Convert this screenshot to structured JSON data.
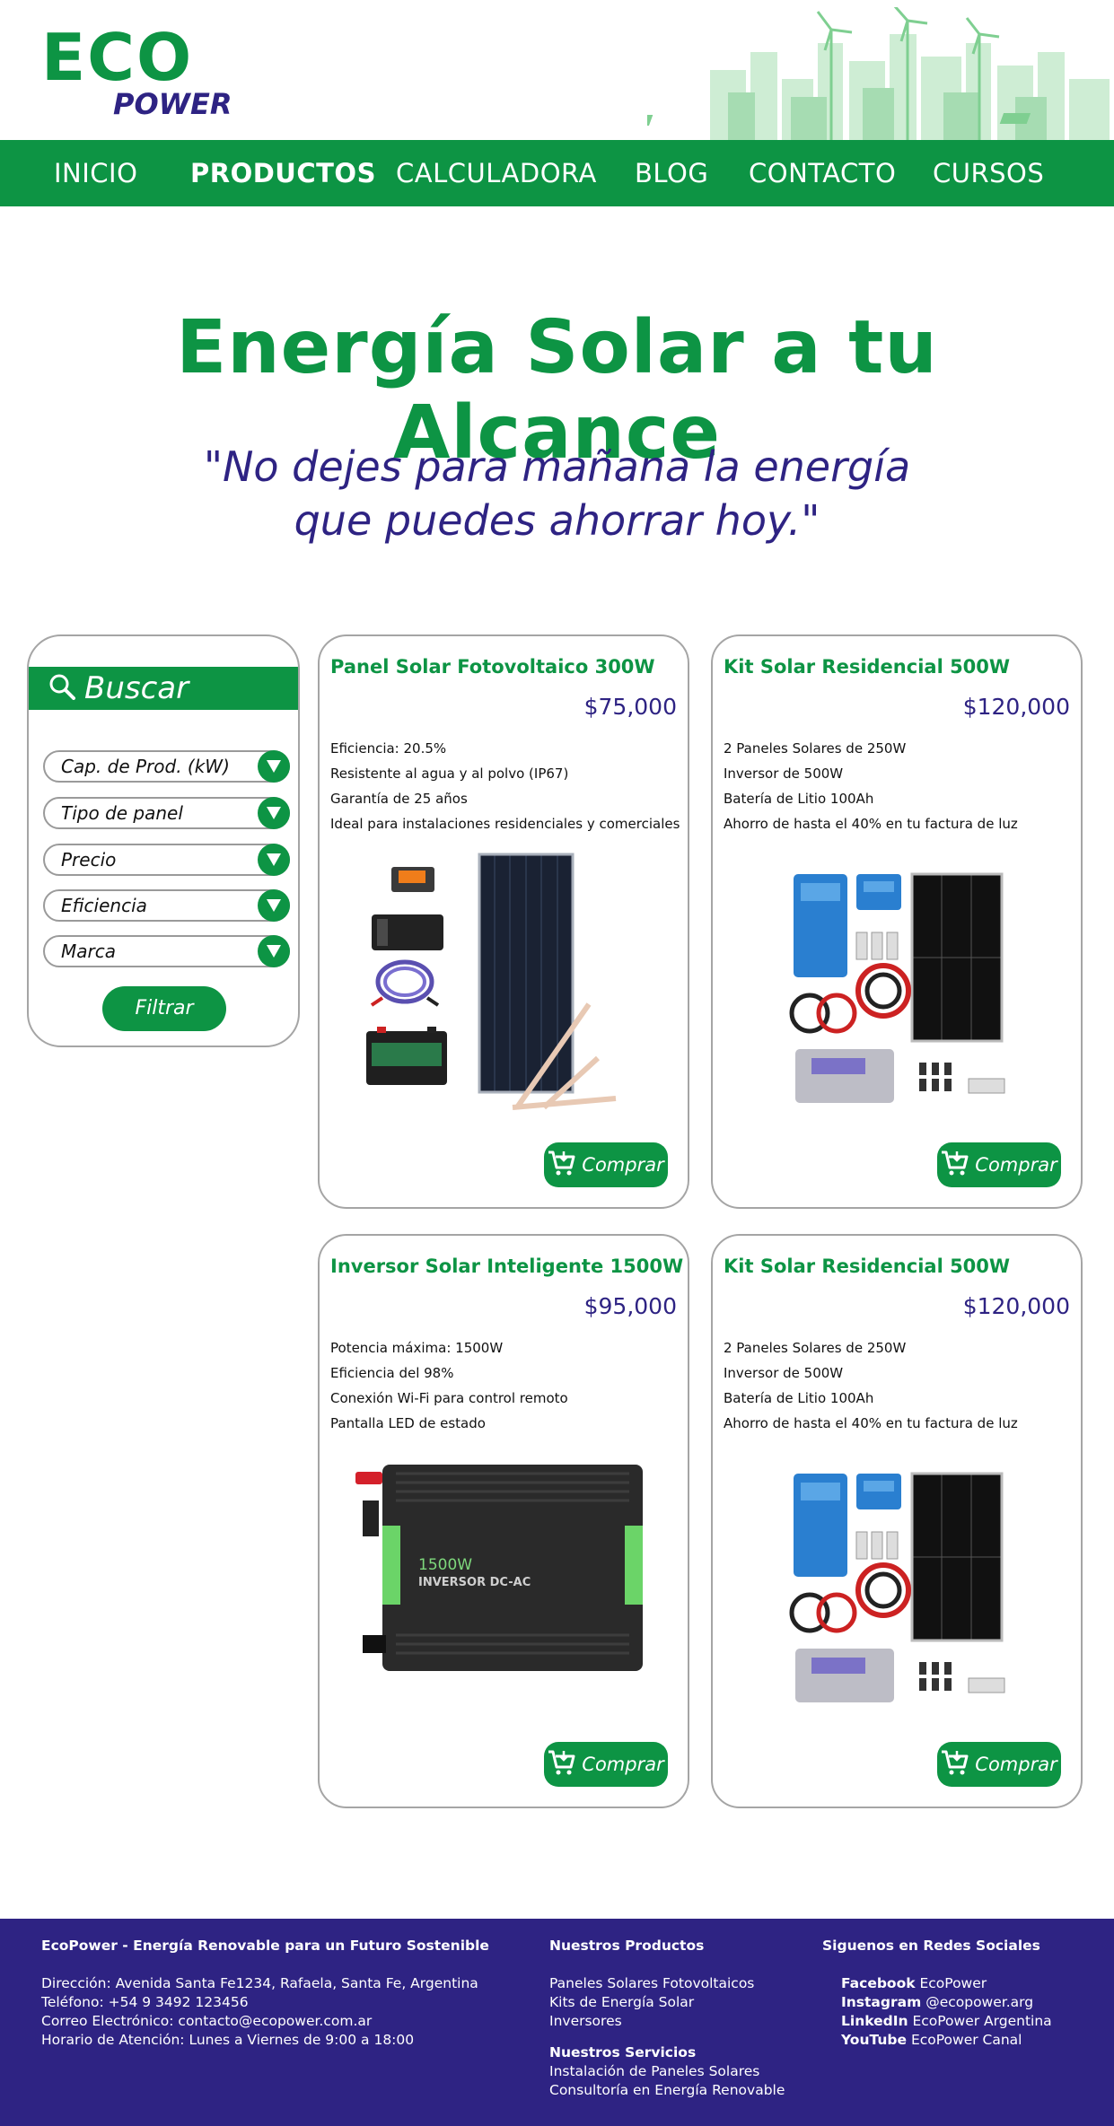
{
  "brand": {
    "logo_top": "ECO",
    "logo_bottom": "POWER"
  },
  "colors": {
    "green": "#0d9444",
    "purple": "#2e2383",
    "border": "#a5a5a5"
  },
  "nav": [
    {
      "label": "INICIO",
      "active": false
    },
    {
      "label": "PRODUCTOS",
      "active": true
    },
    {
      "label": "CALCULADORA",
      "active": false
    },
    {
      "label": "BLOG",
      "active": false
    },
    {
      "label": "CONTACTO",
      "active": false
    },
    {
      "label": "CURSOS",
      "active": false
    }
  ],
  "hero": {
    "title": "Energía Solar a tu Alcance",
    "quote_line1": "\"No dejes para mañana la energía",
    "quote_line2": "que puedes ahorrar hoy.\""
  },
  "search": {
    "title": "Buscar",
    "icon": "search-icon",
    "filters": [
      "Cap. de Prod. (kW)",
      "Tipo de panel",
      "Precio",
      "Eficiencia",
      "Marca"
    ],
    "button": "Filtrar"
  },
  "products": [
    {
      "name": "Panel Solar Fotovoltaico 300W",
      "price": "$75,000",
      "features": [
        "Eficiencia: 20.5%",
        "Resistente al agua y al polvo (IP67)",
        "Garantía de 25 años",
        "Ideal para instalaciones residenciales y comerciales"
      ],
      "image": "solar-panel-kit-image",
      "buy": "Comprar"
    },
    {
      "name": "Kit Solar Residencial 500W",
      "price": "$120,000",
      "features": [
        "2 Paneles Solares de 250W",
        "Inversor de 500W",
        "Batería de Litio 100Ah",
        "Ahorro de hasta el 40% en tu factura de luz"
      ],
      "image": "residential-kit-image",
      "buy": "Comprar"
    },
    {
      "name": "Inversor Solar Inteligente 1500W",
      "price": "$95,000",
      "features": [
        "Potencia máxima: 1500W",
        "Eficiencia del 98%",
        "Conexión Wi-Fi para control remoto",
        "Pantalla LED de estado"
      ],
      "image": "inverter-image",
      "image_text_1": "1500W",
      "image_text_2": "INVERSOR DC-AC",
      "buy": "Comprar"
    },
    {
      "name": "Kit Solar Residencial 500W",
      "price": "$120,000",
      "features": [
        "2 Paneles Solares de 250W",
        "Inversor de 500W",
        "Batería de Litio 100Ah",
        "Ahorro de hasta el 40% en tu factura de luz"
      ],
      "image": "residential-kit-image",
      "buy": "Comprar"
    }
  ],
  "footer": {
    "about_title": "EcoPower - Energía Renovable para un Futuro Sostenible",
    "address": "Dirección: Avenida Santa Fe1234, Rafaela, Santa Fe, Argentina",
    "phone": "Teléfono: +54 9 3492 123456",
    "email": "Correo Electrónico: contacto@ecopower.com.ar",
    "hours": "Horario de Atención: Lunes a Viernes de 9:00 a 18:00",
    "products_title": "Nuestros Productos",
    "products": [
      "Paneles Solares Fotovoltaicos",
      "Kits de Energía Solar",
      "Inversores"
    ],
    "services_title": "Nuestros Servicios",
    "services": [
      "Instalación de Paneles Solares",
      "Consultoría en Energía Renovable"
    ],
    "social_title": "Siguenos en Redes Sociales",
    "social": [
      {
        "network": "Facebook",
        "handle": "EcoPower"
      },
      {
        "network": "Instagram",
        "handle": "@ecopower.arg"
      },
      {
        "network": "LinkedIn",
        "handle": "EcoPower Argentina"
      },
      {
        "network": "YouTube",
        "handle": "EcoPower Canal"
      }
    ]
  }
}
